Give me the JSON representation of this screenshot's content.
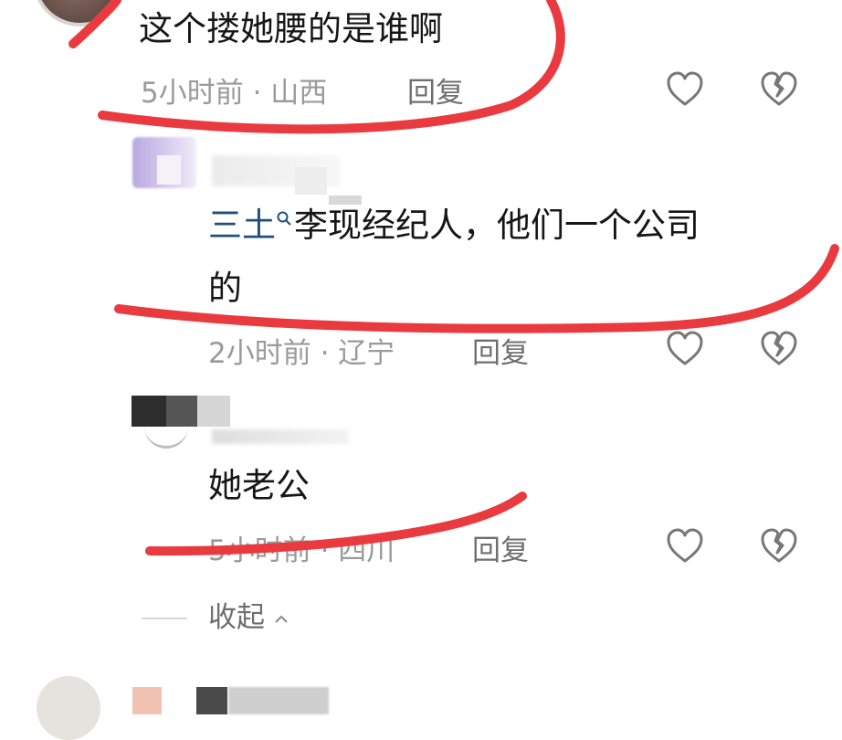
{
  "comments": [
    {
      "text": "这个搂她腰的是谁啊",
      "time": "5小时前",
      "sep": " · ",
      "location": "山西",
      "reply_label": "回复"
    },
    {
      "mention": "三土",
      "text_line1": "李现经纪人，他们一个公司",
      "text_line2": "的",
      "time": "2小时前",
      "sep": " · ",
      "location": "辽宁",
      "reply_label": "回复"
    },
    {
      "text": "她老公",
      "time": "5小时前",
      "sep": " · ",
      "location": "四川",
      "reply_label": "回复"
    }
  ],
  "collapse_label": "收起",
  "colors": {
    "annotation_red": "#e83a3f",
    "mention_blue": "#1f4f7c",
    "meta_gray": "#9a9a9a"
  },
  "icons": [
    "heart-icon",
    "dislike-icon",
    "search-icon",
    "chevron-up-icon"
  ]
}
